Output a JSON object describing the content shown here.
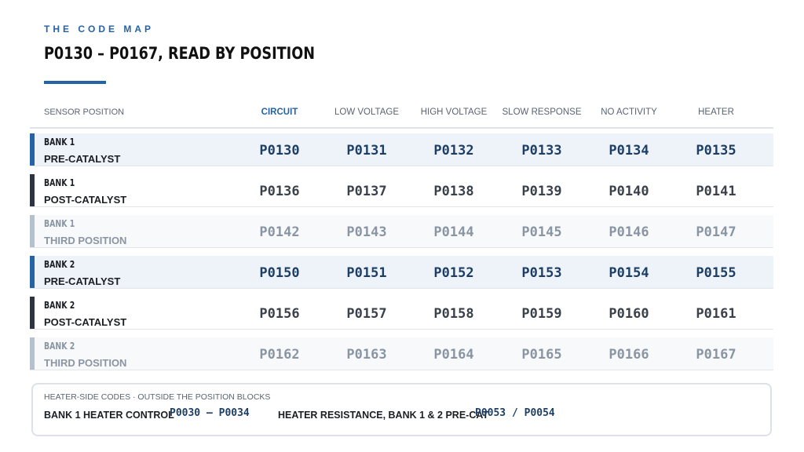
{
  "header": {
    "eyebrow": "THE CODE MAP",
    "title": "P0130 – P0167, READ BY POSITION"
  },
  "table": {
    "position_header": "SENSOR POSITION",
    "columns": [
      "CIRCUIT",
      "LOW VOLTAGE",
      "HIGH VOLTAGE",
      "SLOW RESPONSE",
      "NO ACTIVITY",
      "HEATER"
    ],
    "rows": [
      {
        "bank": "BANK 1",
        "position": "PRE-CATALYST",
        "codes": [
          "P0130",
          "P0131",
          "P0132",
          "P0133",
          "P0134",
          "P0135"
        ]
      },
      {
        "bank": "BANK 1",
        "position": "POST-CATALYST",
        "codes": [
          "P0136",
          "P0137",
          "P0138",
          "P0139",
          "P0140",
          "P0141"
        ]
      },
      {
        "bank": "BANK 1",
        "position": "THIRD POSITION",
        "codes": [
          "P0142",
          "P0143",
          "P0144",
          "P0145",
          "P0146",
          "P0147"
        ]
      },
      {
        "bank": "BANK 2",
        "position": "PRE-CATALYST",
        "codes": [
          "P0150",
          "P0151",
          "P0152",
          "P0153",
          "P0154",
          "P0155"
        ]
      },
      {
        "bank": "BANK 2",
        "position": "POST-CATALYST",
        "codes": [
          "P0156",
          "P0157",
          "P0158",
          "P0159",
          "P0160",
          "P0161"
        ]
      },
      {
        "bank": "BANK 2",
        "position": "THIRD POSITION",
        "codes": [
          "P0162",
          "P0163",
          "P0164",
          "P0165",
          "P0166",
          "P0167"
        ]
      }
    ]
  },
  "footer": {
    "title": "HEATER-SIDE CODES · OUTSIDE THE POSITION BLOCKS",
    "item1_label": "BANK 1 HEATER CONTROL",
    "item1_codes": "P0030 – P0034",
    "item2_label": "HEATER RESISTANCE, BANK 1 & 2 PRE-CAT",
    "item2_codes": "P0053 / P0054"
  },
  "colors": {
    "accent": "#2563a6",
    "dark": "#2b3440",
    "muted": "#b4c0cd",
    "code_primary": "#1d3f66"
  }
}
